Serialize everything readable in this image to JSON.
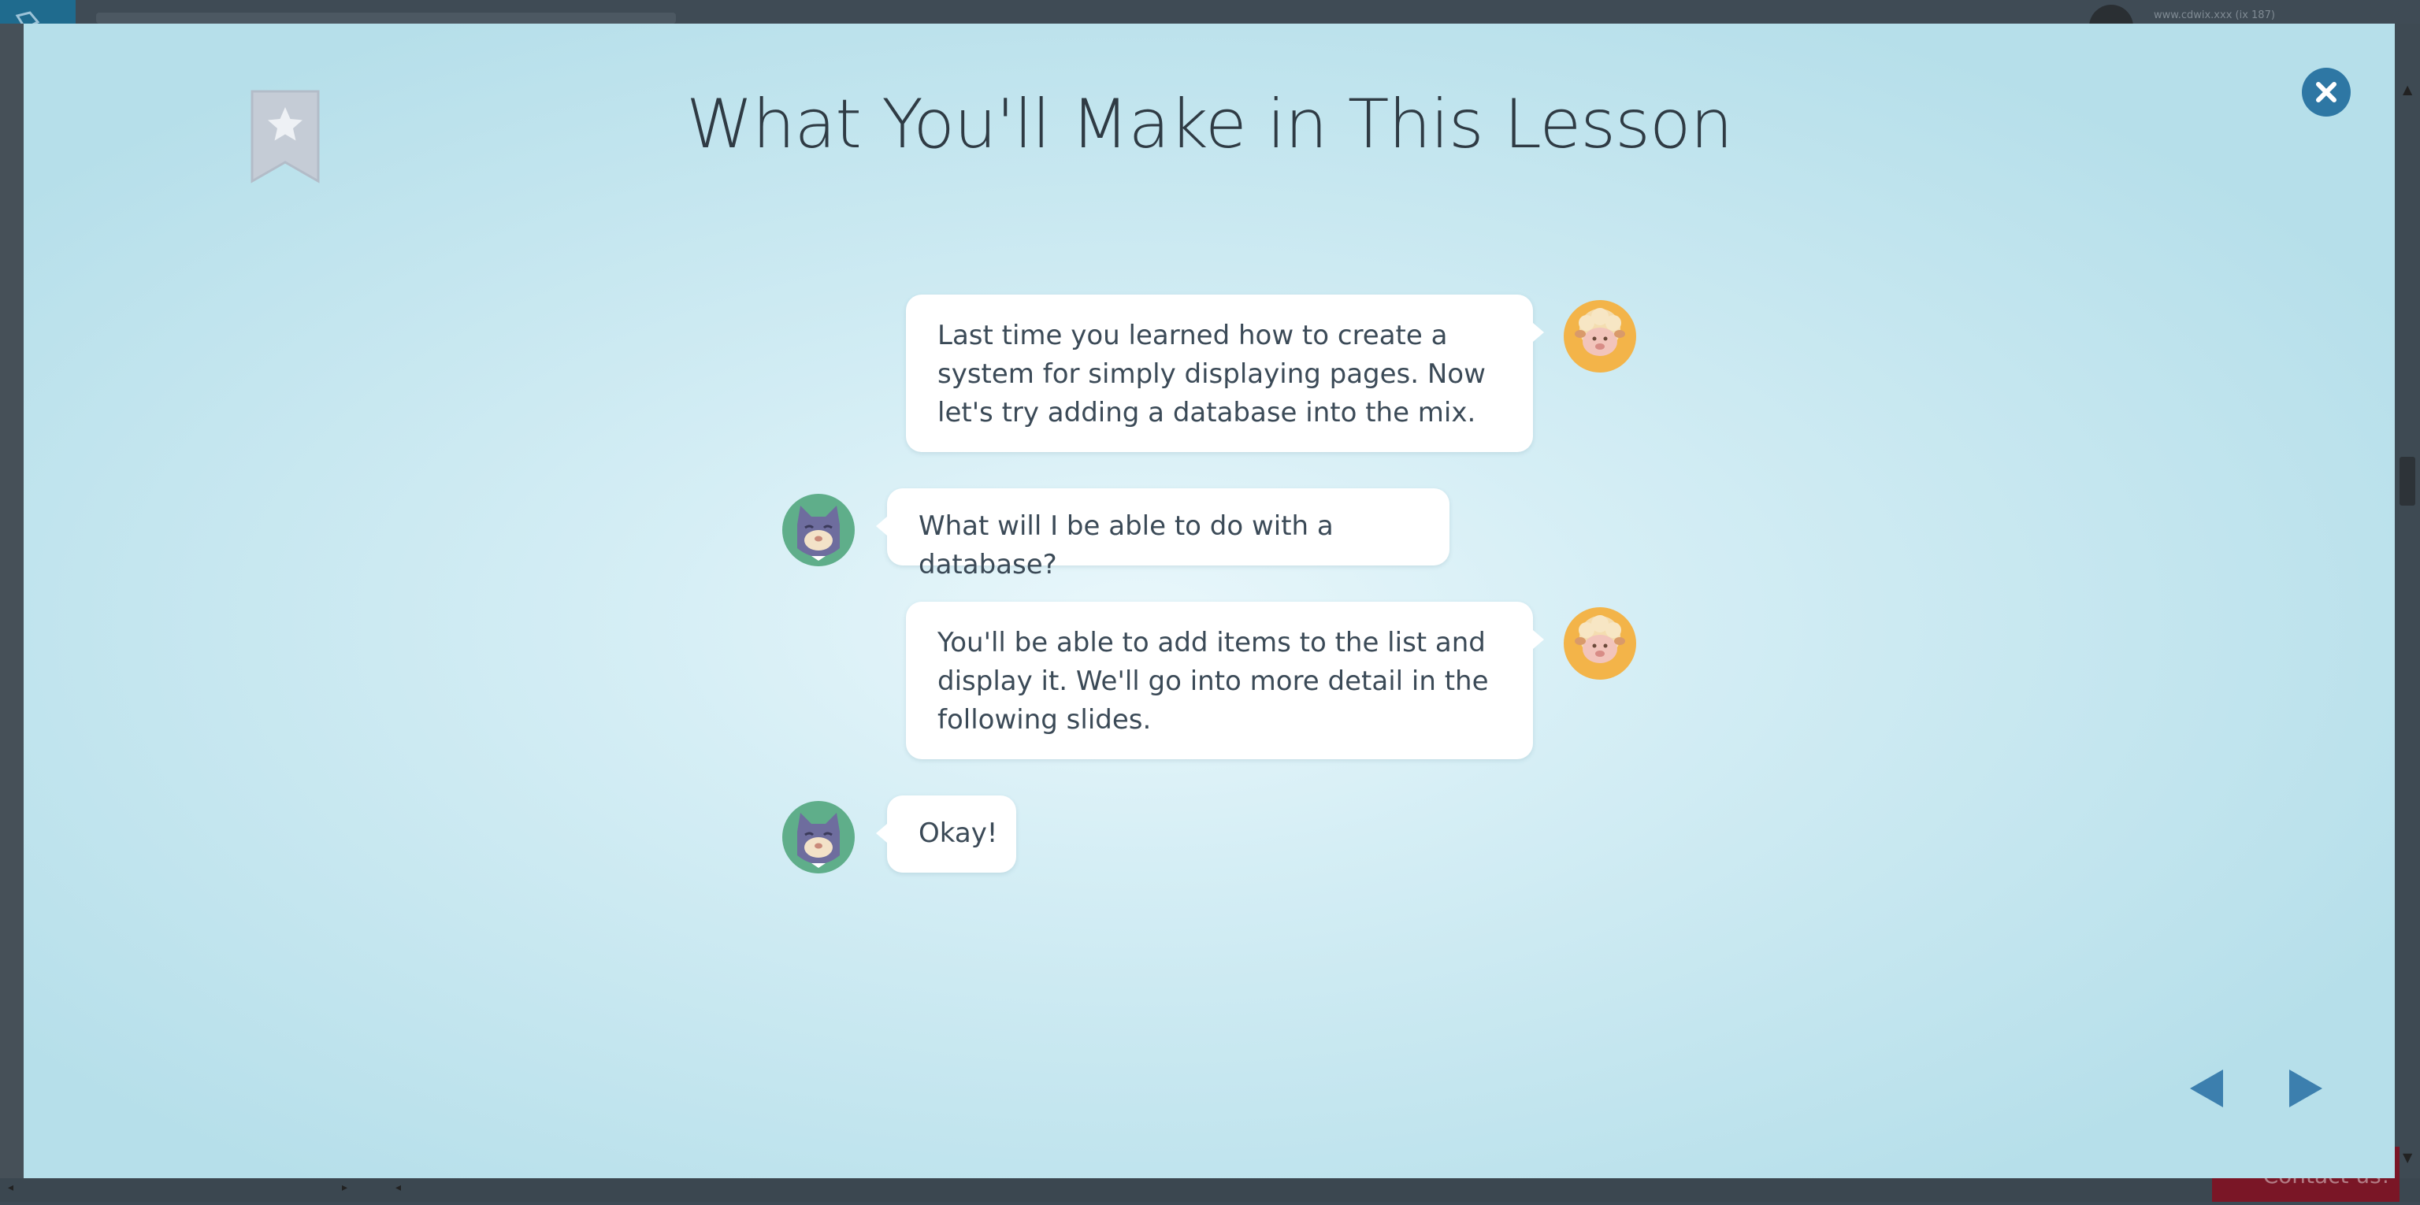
{
  "lesson": {
    "title": "What You'll Make in This Lesson",
    "messages": [
      {
        "speaker": "sheep",
        "side": "right",
        "text": "Last time you learned how to create a system for simply displaying pages. Now let's try adding a database into the mix."
      },
      {
        "speaker": "cat",
        "side": "left",
        "text": "What will I be able to do with a database?"
      },
      {
        "speaker": "sheep",
        "side": "right",
        "text": "You'll be able to add items to the list and display it. We'll go into more detail in the following slides."
      },
      {
        "speaker": "cat",
        "side": "left",
        "text": "Okay!"
      }
    ]
  },
  "background": {
    "user_text": "www.cdwix.xxx (ix 187)",
    "contact_label": "Contact us!"
  },
  "icons": {
    "bookmark": "bookmark-star-icon",
    "close": "close-icon",
    "prev": "prev-arrow-icon",
    "next": "next-arrow-icon",
    "sheep": "sheep-avatar",
    "cat": "cat-avatar"
  },
  "colors": {
    "close_button": "#2e77a4",
    "nav_arrows": "#3c7fae",
    "title_text": "#2f3b44",
    "bubble_text": "#3b4a57",
    "bookmark": "#c5ccd6"
  }
}
